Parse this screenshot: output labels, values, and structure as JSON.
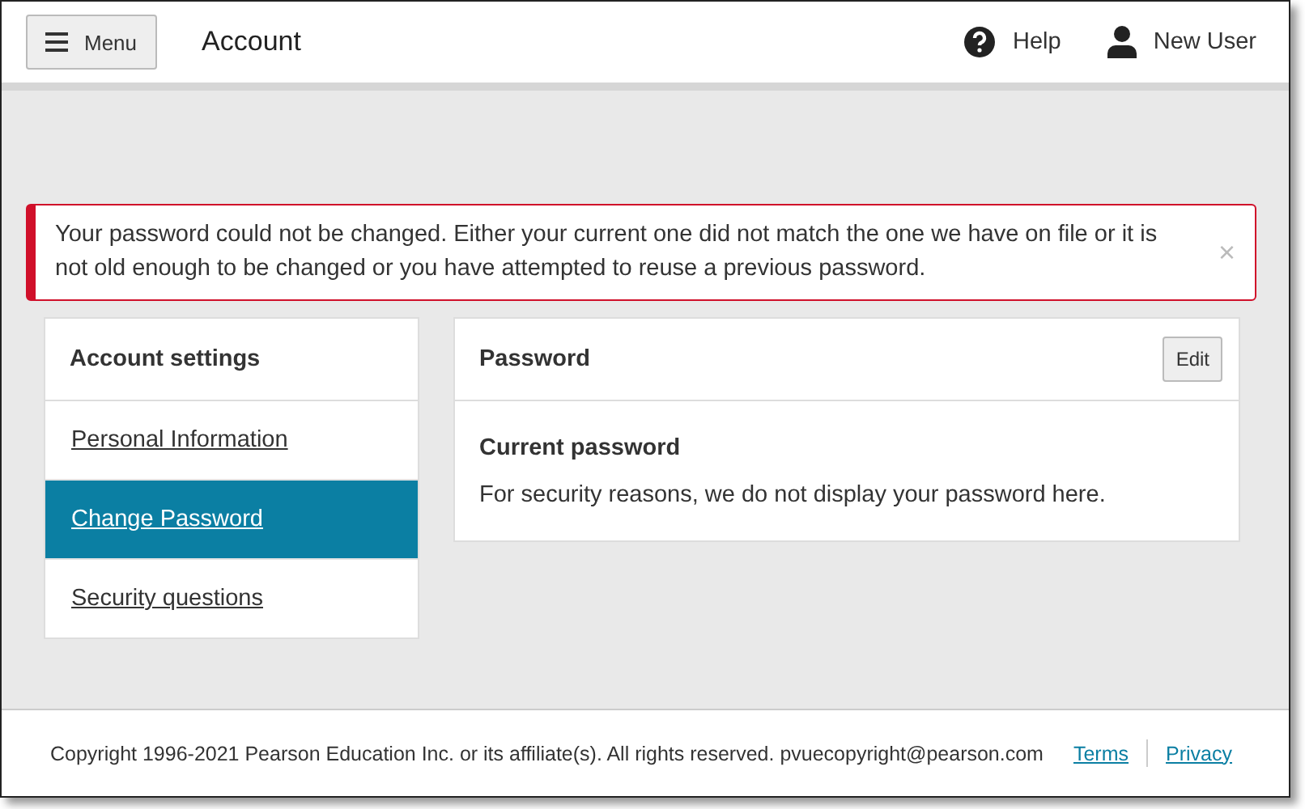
{
  "header": {
    "menu_button": "Menu",
    "title": "Account",
    "help": "Help",
    "user": "New User"
  },
  "alert": {
    "message": "Your password could not be changed. Either your current one did not match the one we have on file or it is not old enough to be changed or you have attempted to reuse a previous password.",
    "close": "×"
  },
  "sidebar": {
    "title": "Account settings",
    "items": [
      {
        "label": "Personal Information",
        "selected": false
      },
      {
        "label": "Change Password",
        "selected": true
      },
      {
        "label": "Security questions",
        "selected": false
      }
    ]
  },
  "panel": {
    "title": "Password",
    "edit_button": "Edit",
    "heading": "Current password",
    "text": "For security reasons, we do not display your password here."
  },
  "footer": {
    "copyright": "Copyright 1996-2021 Pearson Education Inc. or its affiliate(s). All rights reserved. pvuecopyright@pearson.com",
    "links": [
      "Terms",
      "Privacy"
    ]
  }
}
